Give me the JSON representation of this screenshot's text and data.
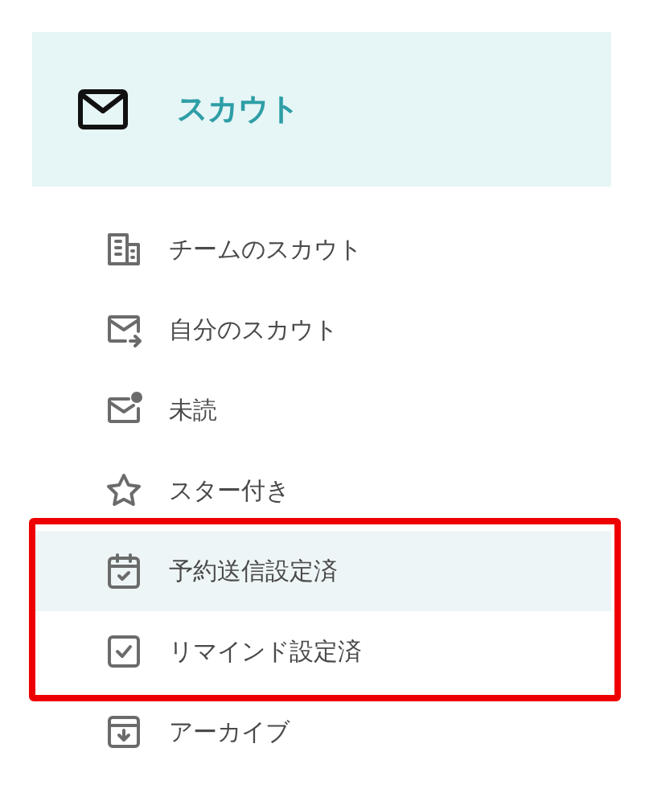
{
  "header": {
    "title": "スカウト",
    "selected": true
  },
  "items": [
    {
      "label": "チームのスカウト",
      "selected": false,
      "outlined": false
    },
    {
      "label": "自分のスカウト",
      "selected": false,
      "outlined": false
    },
    {
      "label": "未読",
      "selected": false,
      "outlined": false
    },
    {
      "label": "スター付き",
      "selected": false,
      "outlined": false
    },
    {
      "label": "予約送信設定済",
      "selected": true,
      "outlined": true
    },
    {
      "label": "リマインド設定済",
      "selected": false,
      "outlined": true
    },
    {
      "label": "アーカイブ",
      "selected": false,
      "outlined": false
    }
  ]
}
